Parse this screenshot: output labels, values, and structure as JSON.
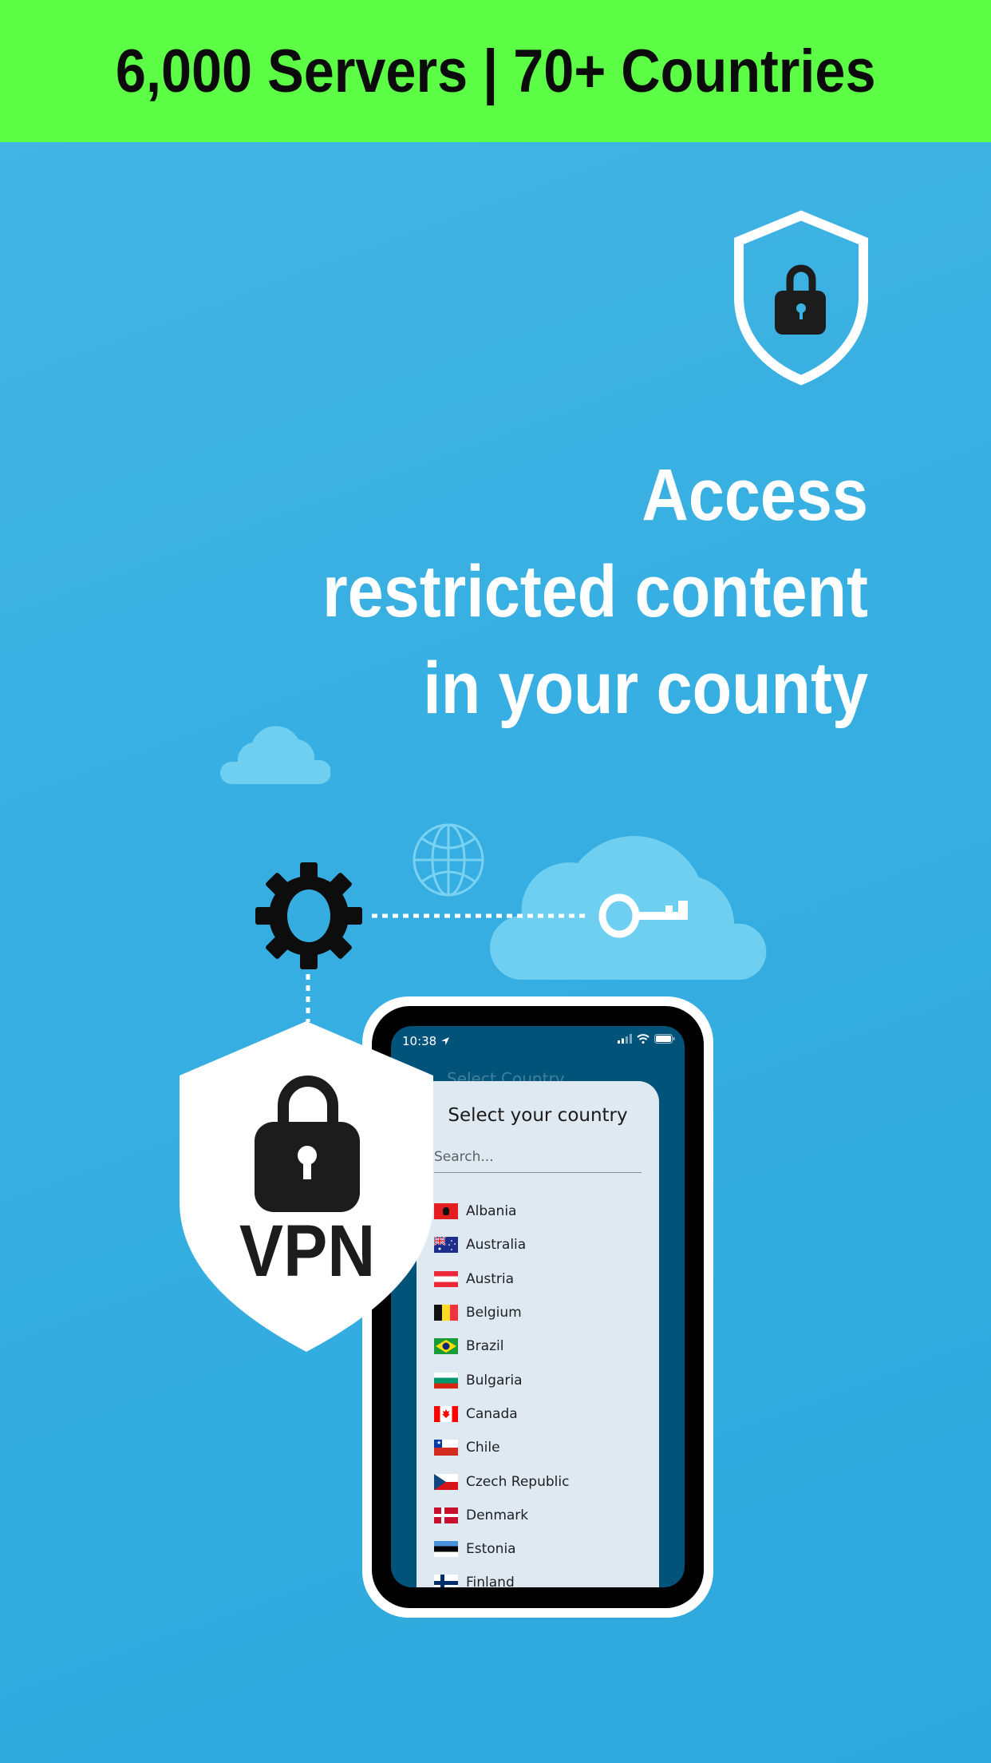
{
  "banner": {
    "text": "6,000 Servers | 70+ Countries",
    "background_color": "#5cff45"
  },
  "headline": {
    "lines": [
      "Access",
      "restricted content",
      "in your county"
    ]
  },
  "illustration": {
    "icons": [
      "shield-lock-icon",
      "cloud-icon",
      "globe-icon",
      "gear-icon",
      "key-icon",
      "vpn-shield-icon"
    ],
    "vpn_label": "VPN"
  },
  "phone": {
    "status_bar": {
      "time": "10:38",
      "icons": [
        "location-arrow-icon",
        "signal-icon",
        "wifi-icon",
        "battery-icon"
      ]
    },
    "background_title": "Select Country",
    "sheet": {
      "title": "Select your country",
      "search_placeholder": "Search...",
      "search_value": "",
      "countries": [
        {
          "name": "Albania",
          "flag": "albania-flag-icon"
        },
        {
          "name": "Australia",
          "flag": "australia-flag-icon"
        },
        {
          "name": "Austria",
          "flag": "austria-flag-icon"
        },
        {
          "name": "Belgium",
          "flag": "belgium-flag-icon"
        },
        {
          "name": "Brazil",
          "flag": "brazil-flag-icon"
        },
        {
          "name": "Bulgaria",
          "flag": "bulgaria-flag-icon"
        },
        {
          "name": "Canada",
          "flag": "canada-flag-icon"
        },
        {
          "name": "Chile",
          "flag": "chile-flag-icon"
        },
        {
          "name": "Czech Republic",
          "flag": "czech-republic-flag-icon"
        },
        {
          "name": "Denmark",
          "flag": "denmark-flag-icon"
        },
        {
          "name": "Estonia",
          "flag": "estonia-flag-icon"
        },
        {
          "name": "Finland",
          "flag": "finland-flag-icon"
        }
      ]
    }
  },
  "colors": {
    "background": "#38afe2",
    "phone_screen": "#02537a",
    "sheet": "#dfe9f2",
    "cloud": "#6ecff0"
  }
}
